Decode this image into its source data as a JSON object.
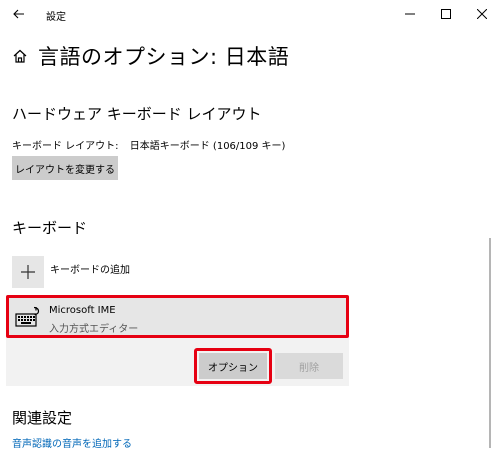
{
  "window": {
    "title": "設定",
    "back_icon": "back-arrow-icon",
    "controls": [
      "minimize-icon",
      "maximize-icon",
      "close-icon"
    ]
  },
  "header": {
    "home_icon": "home-icon",
    "title": "言語のオプション: 日本語"
  },
  "hardware_layout": {
    "heading": "ハードウェア キーボード レイアウト",
    "layout_label": "キーボード レイアウト:",
    "layout_value": "日本語キーボード (106/109 キー)",
    "change_button": "レイアウトを変更する"
  },
  "keyboard": {
    "heading": "キーボード",
    "add_label": "キーボードの追加",
    "add_icon": "plus-icon",
    "items": [
      {
        "name": "Microsoft IME",
        "description": "入力方式エディター",
        "icon": "keyboard-icon"
      }
    ],
    "options_button": "オプション",
    "remove_button": "削除"
  },
  "related": {
    "heading": "関連設定",
    "link": "音声認識の音声を追加する"
  },
  "colors": {
    "highlight_red": "#e60012",
    "link_blue": "#0067b8",
    "button_gray": "#cccccc"
  }
}
